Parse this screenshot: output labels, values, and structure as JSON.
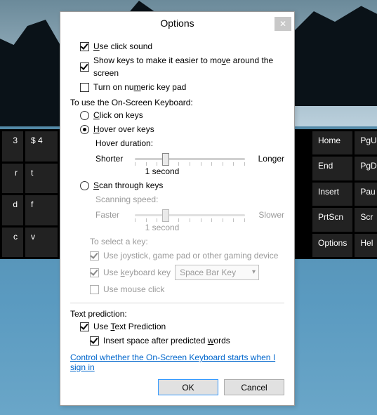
{
  "background": {
    "osk_left_keys": [
      [
        "3",
        "$ 4"
      ],
      [
        "r",
        "t"
      ],
      [
        "d",
        "f"
      ],
      [
        "c",
        "v"
      ]
    ],
    "osk_right_keys": [
      [
        "Home",
        "PgU"
      ],
      [
        "End",
        "PgD"
      ],
      [
        "Insert",
        "Pau"
      ],
      [
        "PrtScn",
        "Scr"
      ],
      [
        "Options",
        "Hel"
      ]
    ]
  },
  "dialog": {
    "title": "Options",
    "use_click_sound": {
      "label_pre": "",
      "u": "U",
      "label": "se click sound",
      "checked": true
    },
    "show_keys": {
      "label": "Show keys to make it easier to mo",
      "u": "v",
      "label2": "e around the screen",
      "checked": true
    },
    "numeric_keypad": {
      "label": "Turn on nu",
      "u": "m",
      "label2": "eric key pad",
      "checked": false
    },
    "onscreen_label": "To use the On-Screen Keyboard:",
    "mode": {
      "click": {
        "u": "C",
        "label": "lick on keys",
        "checked": false
      },
      "hover": {
        "u": "H",
        "label": "over over keys",
        "checked": true
      },
      "scan": {
        "u": "S",
        "label": "can through keys",
        "checked": false
      }
    },
    "hover": {
      "duration_label": "Hover duration:",
      "shorter": "Shorter",
      "longer": "Longer",
      "value": "1 second"
    },
    "scan": {
      "speed_label": "Scanning speed:",
      "faster": "Faster",
      "slower": "Slower",
      "value": "1 second",
      "select_label": "To select a key:",
      "joystick": {
        "label": "Use joystick, game pad or other gaming device",
        "checked": true
      },
      "keyboard": {
        "label_pre": "Use ",
        "u": "k",
        "label": "eyboard key",
        "checked": true,
        "key": "Space Bar Key"
      },
      "mouse": {
        "label": "Use mouse click",
        "checked": false
      }
    },
    "text_prediction": {
      "section": "Text prediction:",
      "use": {
        "label_pre": "Use ",
        "u": "T",
        "label": "ext Prediction",
        "checked": true
      },
      "insert": {
        "label": "Insert space after predicted ",
        "u": "w",
        "label2": "ords",
        "checked": true
      }
    },
    "link": "Control whether the On-Screen Keyboard starts when I sign in",
    "buttons": {
      "ok": "OK",
      "cancel": "Cancel"
    }
  }
}
